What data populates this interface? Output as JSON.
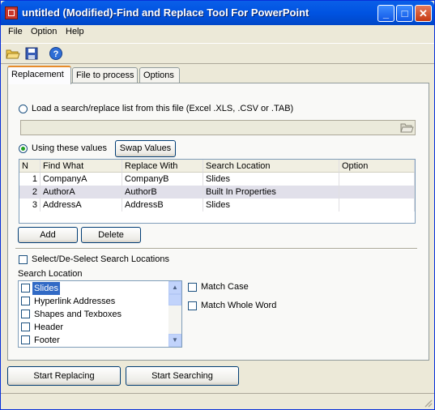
{
  "window": {
    "title": "untitled (Modified)-Find and Replace Tool For PowerPoint",
    "controls": {
      "minimize": "_",
      "maximize": "□",
      "close": "✕"
    }
  },
  "menu": [
    "File",
    "Option",
    "Help"
  ],
  "toolbar": {
    "icons": [
      "open-folder-icon",
      "save-icon",
      "help-icon"
    ]
  },
  "tabs": [
    "Replacement",
    "File to process",
    "Options"
  ],
  "replacement": {
    "load_radio_label": "Load a search/replace list from this file (Excel .XLS, .CSV or .TAB)",
    "file_path": "",
    "using_radio_label": "Using these values",
    "swap_button": "Swap Values",
    "table": {
      "columns": [
        "N",
        "Find What",
        "Replace With",
        "Search Location",
        "Option"
      ],
      "rows": [
        [
          "1",
          "CompanyA",
          "CompanyB",
          "Slides",
          ""
        ],
        [
          "2",
          "AuthorA",
          "AuthorB",
          "Built In Properties",
          ""
        ],
        [
          "3",
          "AddressA",
          "AddressB",
          "Slides",
          ""
        ]
      ],
      "selected_row": 2
    },
    "add_button": "Add",
    "delete_button": "Delete",
    "select_all_label": "Select/De-Select Search Locations",
    "search_location_label": "Search Location",
    "locations": [
      "Slides",
      "Hyperlink Addresses",
      "Shapes and Texboxes",
      "Header",
      "Footer"
    ],
    "selected_location": "Slides",
    "match_case_label": "Match Case",
    "match_whole_word_label": "Match Whole Word"
  },
  "actions": {
    "start_replacing": "Start Replacing",
    "start_searching": "Start Searching"
  },
  "colors": {
    "title_bar": "#0053E1",
    "selection": "#316AC5",
    "tab_highlight": "#E68B2C",
    "window_bg": "#ECE9D8"
  }
}
